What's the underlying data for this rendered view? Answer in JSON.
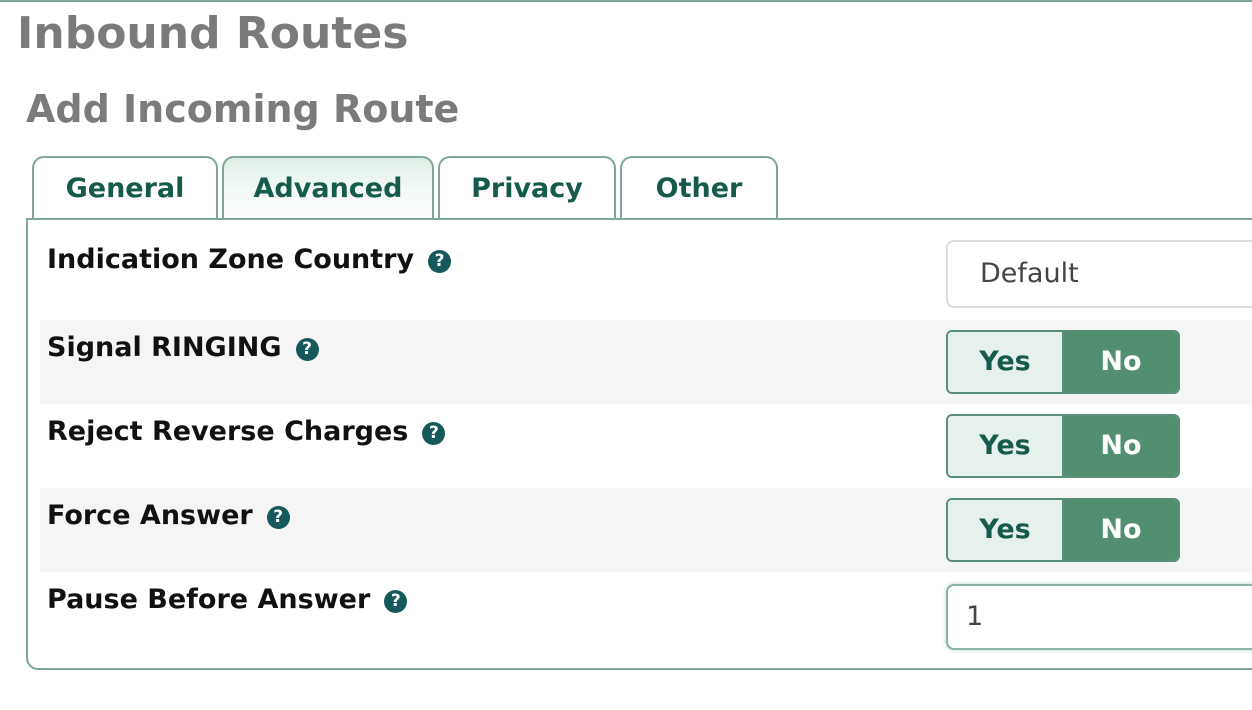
{
  "page": {
    "title": "Inbound Routes",
    "section_title": "Add Incoming Route"
  },
  "tabs": [
    {
      "label": "General",
      "active": false
    },
    {
      "label": "Advanced",
      "active": true
    },
    {
      "label": "Privacy",
      "active": false
    },
    {
      "label": "Other",
      "active": false
    }
  ],
  "fields": {
    "indication_zone": {
      "label": "Indication Zone Country",
      "value": "Default",
      "help_icon": "question-circle-icon"
    },
    "signal_ringing": {
      "label": "Signal RINGING",
      "yes_label": "Yes",
      "no_label": "No",
      "selected": "No",
      "help_icon": "question-circle-icon"
    },
    "reject_reverse": {
      "label": "Reject Reverse Charges",
      "yes_label": "Yes",
      "no_label": "No",
      "selected": "No",
      "help_icon": "question-circle-icon"
    },
    "force_answer": {
      "label": "Force Answer",
      "yes_label": "Yes",
      "no_label": "No",
      "selected": "No",
      "help_icon": "question-circle-icon"
    },
    "pause_before_answer": {
      "label": "Pause Before Answer",
      "value": "1",
      "help_icon": "question-circle-icon"
    }
  },
  "help_glyph": "?",
  "colors": {
    "accent": "#7fa795",
    "tab_text": "#165a4c",
    "toggle_selected": "#528f71",
    "toggle_unselected": "#e6f0ec",
    "help_icon": "#16595b",
    "title": "#7b7b7b"
  }
}
